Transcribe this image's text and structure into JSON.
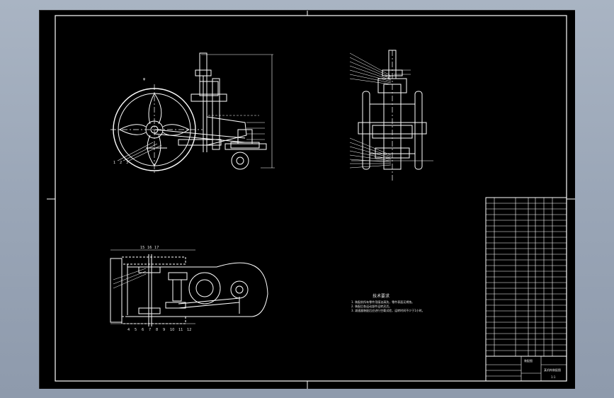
{
  "canvas": {
    "background": "#000000",
    "window_background": "#9aa6b7",
    "line_color": "#ffffff",
    "accent_color": "#e6e6e6"
  },
  "tech_requirements": {
    "title": "技术要求",
    "items": [
      "1. 装配前所有零件用煤油清洗，零件表面无锈蚀。",
      "2. 装配后各运动部件运转灵活。",
      "3. 减速器装配后应进行空载试验，运转时间不少于1小时。"
    ]
  },
  "leader_labels": {
    "side_view_top_note": "φ",
    "front_view_numbers": [
      "1",
      "2",
      "3"
    ],
    "plan_view_top_numbers": [
      "15",
      "16",
      "17"
    ],
    "plan_view_bottom_numbers": [
      "4",
      "5",
      "6",
      "7",
      "8",
      "9",
      "10",
      "11",
      "12"
    ]
  },
  "title_block": {
    "drawing_name": "某机构装配图",
    "material_scale": "1:1",
    "org": "装配图",
    "rows": 28
  }
}
